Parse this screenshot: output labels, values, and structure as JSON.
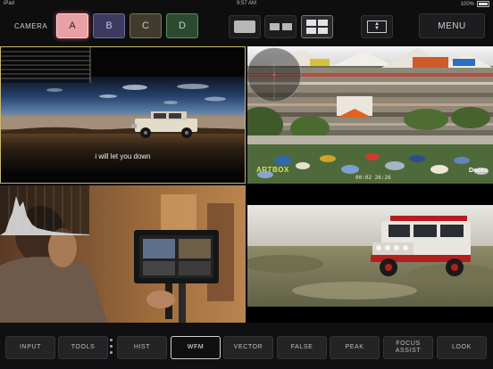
{
  "status": {
    "device": "iPad",
    "time": "9:57 AM",
    "battery": "100%"
  },
  "header": {
    "camera_label": "CAMERA",
    "cameras": [
      "A",
      "B",
      "C",
      "D"
    ],
    "selected_camera": "A",
    "layouts": [
      "single-view",
      "dual-view",
      "quad-view"
    ],
    "selected_layout": "quad-view",
    "menu_label": "MENU",
    "colors": {
      "A": "#e8a0a6",
      "B": "#3c3a5e",
      "C": "#403b2c",
      "D": "#2b4a30"
    }
  },
  "viewers": {
    "tile_a": {
      "subtitle": "i will let you down"
    },
    "tile_b": {
      "logo": "ARTBOX",
      "timecode": "00:02 26:26",
      "brand": "Docex"
    },
    "tile_c": {},
    "tile_d": {}
  },
  "toolbar": {
    "input": "INPUT",
    "tools": "TOOLS",
    "hist": "HIST",
    "wfm": "WFM",
    "vector": "VECTOR",
    "false": "FALSE",
    "peak": "PEAK",
    "focus_assist_1": "FOCUS",
    "focus_assist_2": "ASSIST",
    "look": "LOOK",
    "active": "WFM"
  }
}
